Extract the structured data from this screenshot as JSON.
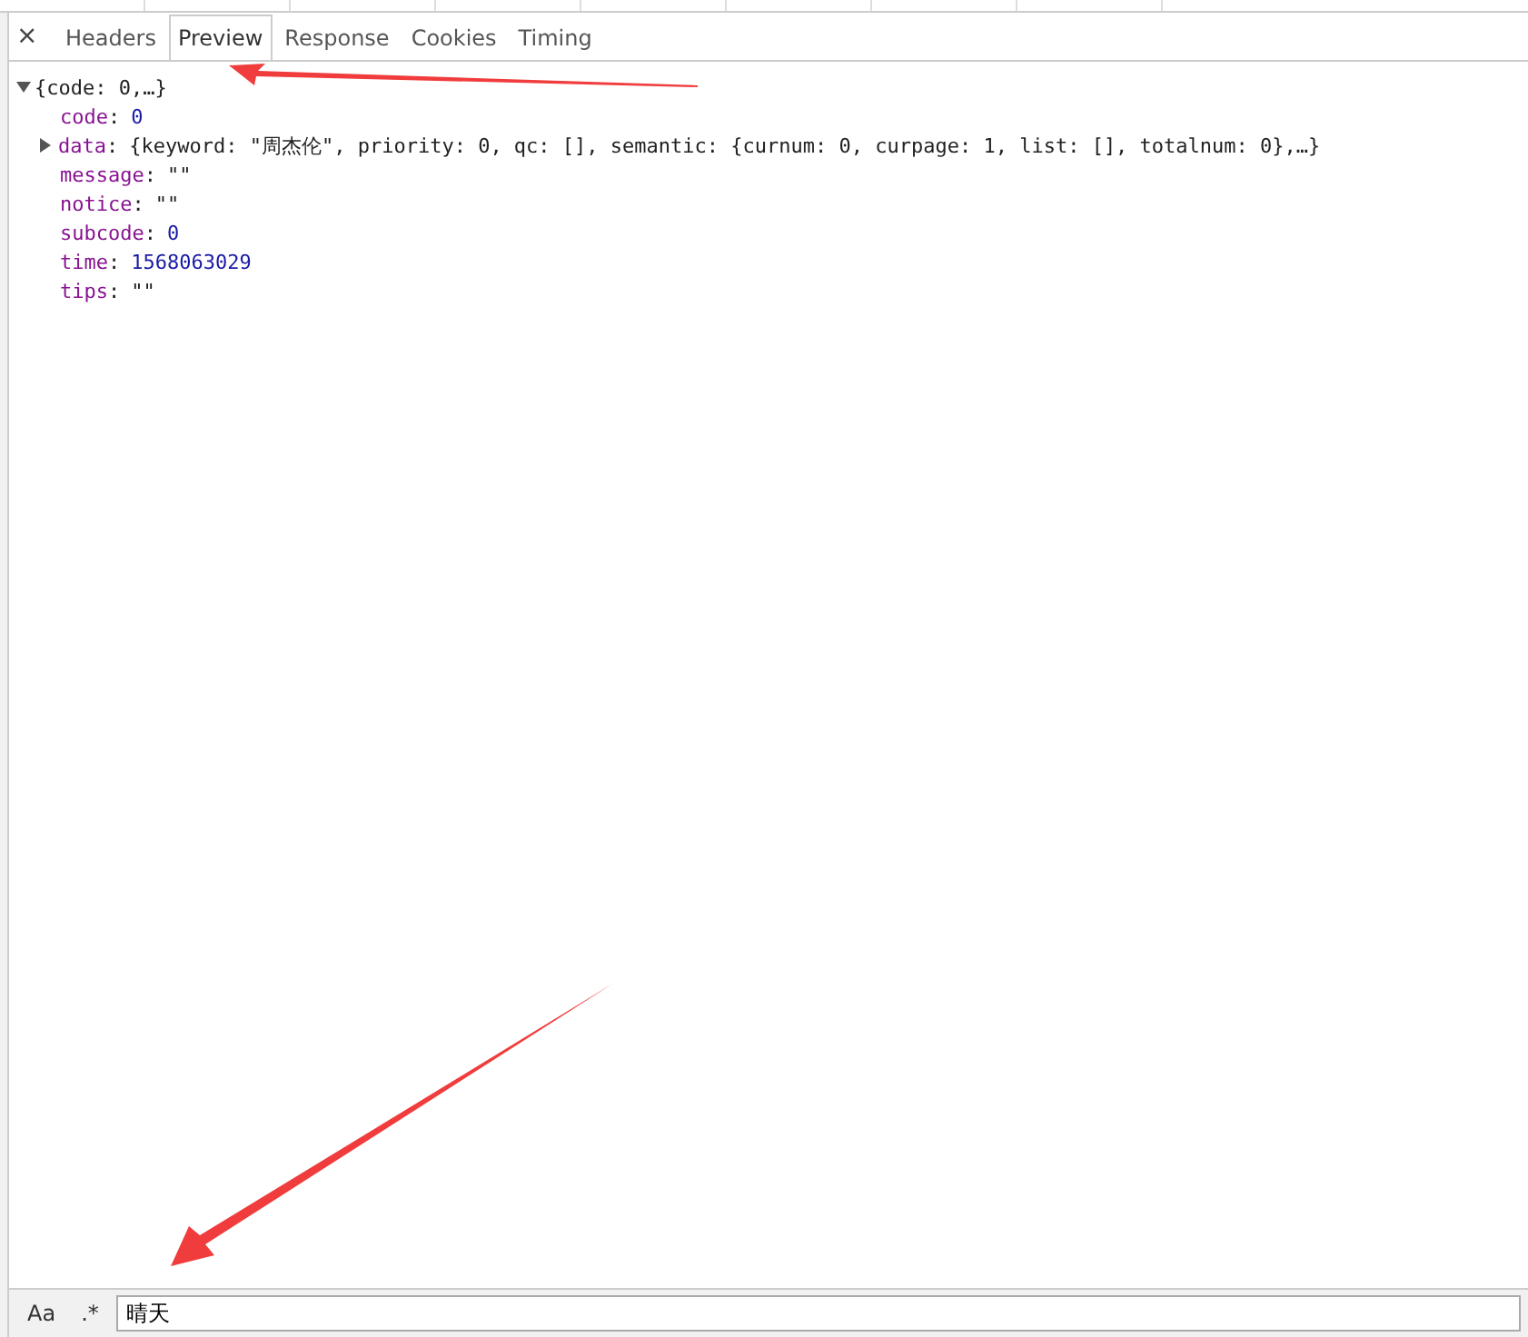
{
  "close_glyph": "×",
  "tabs": [
    {
      "label": "Headers",
      "selected": false
    },
    {
      "label": "Preview",
      "selected": true
    },
    {
      "label": "Response",
      "selected": false
    },
    {
      "label": "Cookies",
      "selected": false
    },
    {
      "label": "Timing",
      "selected": false
    }
  ],
  "tree": {
    "summary": "{code: 0,…}",
    "expanded": true,
    "key_separator": ":",
    "children": [
      {
        "key": "code",
        "value": "0",
        "kind": "number"
      },
      {
        "key": "data",
        "value": "{keyword: \"周杰伦\", priority: 0, qc: [], semantic: {curnum: 0, curpage: 1, list: [], totalnum: 0},…}",
        "kind": "object",
        "expanded": false
      },
      {
        "key": "message",
        "value": "\"\"",
        "kind": "string"
      },
      {
        "key": "notice",
        "value": "\"\"",
        "kind": "string"
      },
      {
        "key": "subcode",
        "value": "0",
        "kind": "number"
      },
      {
        "key": "time",
        "value": "1568063029",
        "kind": "number"
      },
      {
        "key": "tips",
        "value": "\"\"",
        "kind": "string"
      }
    ]
  },
  "search": {
    "case_label": "Aa",
    "regex_label": ".*",
    "value": "晴天"
  }
}
